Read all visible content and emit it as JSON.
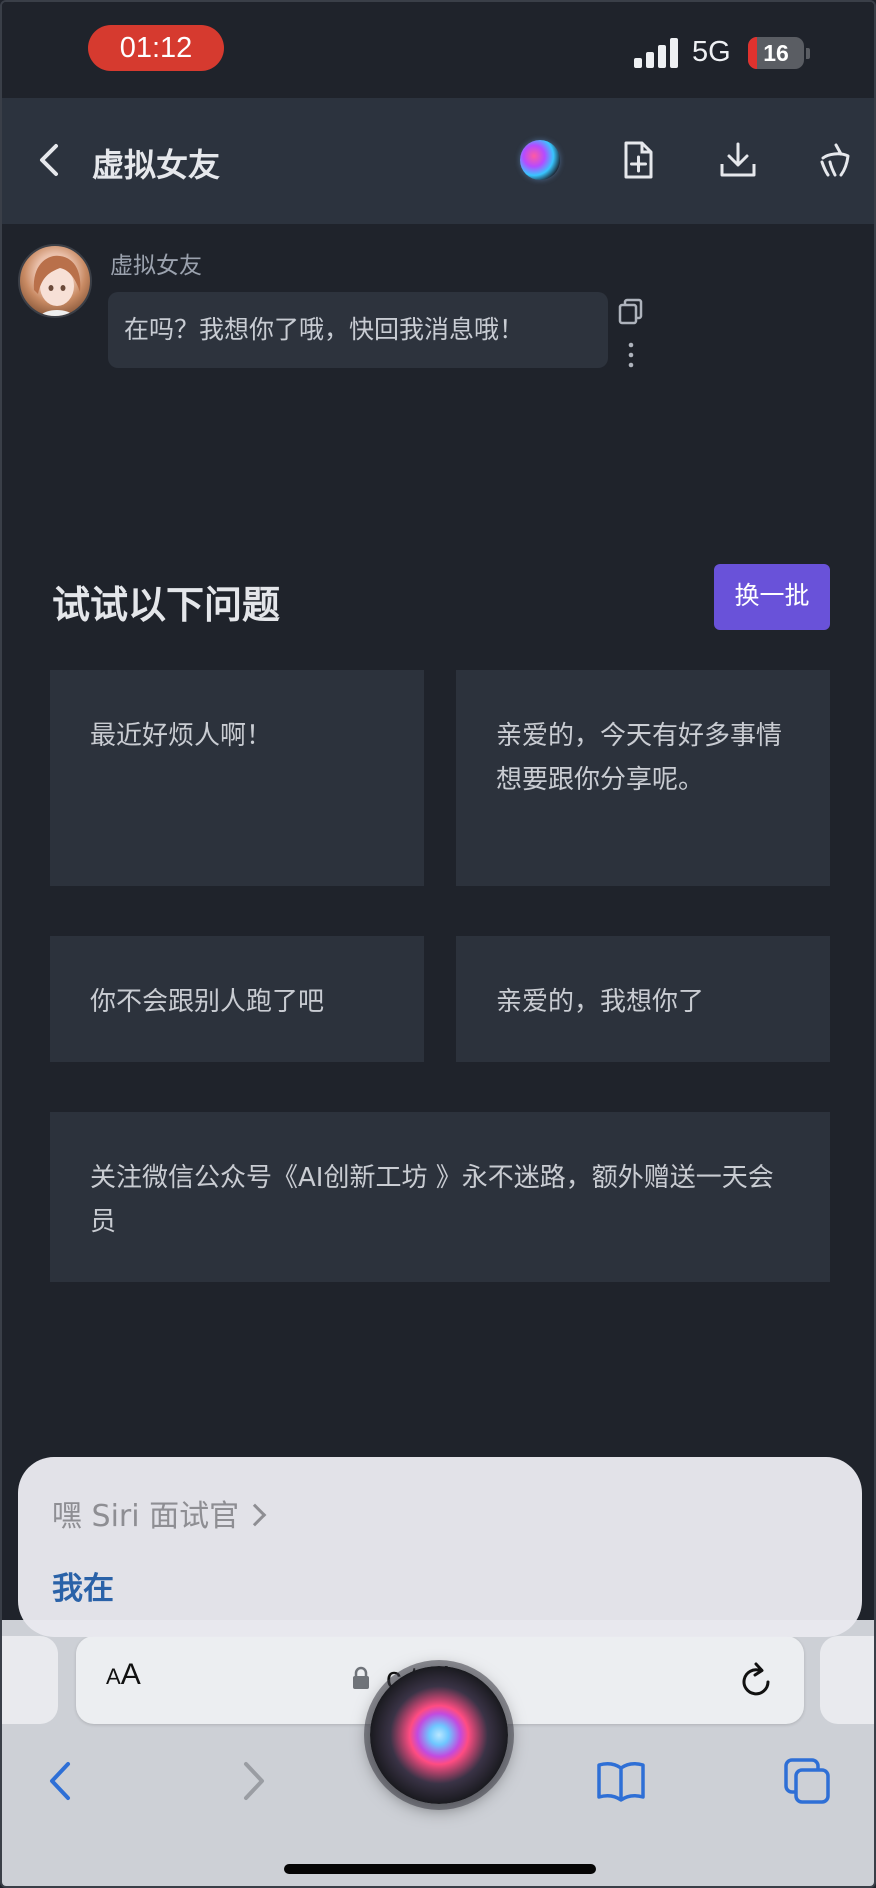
{
  "status_bar": {
    "time": "01:12",
    "network": "5G",
    "battery_level": "16",
    "battery_fraction": 0.16
  },
  "header": {
    "title": "虚拟女友",
    "icons": [
      "back-chevron-icon",
      "siri-orb-icon",
      "new-document-icon",
      "download-icon",
      "clean-icon"
    ]
  },
  "chat": {
    "sender_name": "虚拟女友",
    "message": "在吗？我想你了哦，快回我消息哦！",
    "message_icons": [
      "copy-icon",
      "more-vertical-icon"
    ]
  },
  "suggestions": {
    "title": "试试以下问题",
    "refresh_label": "换一批",
    "cards": [
      "最近好烦人啊！",
      "亲爱的，今天有好多事情想要跟你分享呢。",
      "你不会跟别人跑了吧",
      "亲爱的，我想你了",
      "关注微信公众号《AI创新工坊 》永不迷路，额外赠送一天会员"
    ]
  },
  "siri": {
    "query": "嘿 Siri 面试官",
    "reply": "我在"
  },
  "browser": {
    "text_size_label_small": "A",
    "text_size_label_large": "A",
    "url": "c        t.vip",
    "icons": [
      "lock-icon",
      "reload-icon",
      "back-arrow-icon",
      "forward-arrow-icon",
      "bookmarks-icon",
      "tabs-icon"
    ]
  },
  "colors": {
    "background": "#1f232b",
    "header": "#2c333e",
    "card": "#2c323c",
    "accent": "#6952d9",
    "siri_reply": "#2a62a8"
  }
}
